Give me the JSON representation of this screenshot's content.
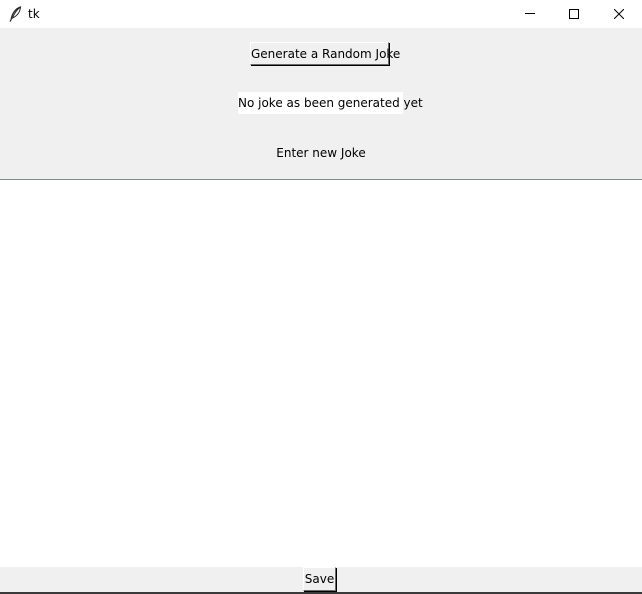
{
  "window": {
    "title": "tk",
    "icon": "feather-icon",
    "controls": [
      "minimize-icon",
      "maximize-icon",
      "close-icon"
    ]
  },
  "main": {
    "generate_button_label": "Generate a Random Joke",
    "joke_display_text": "No joke as been generated yet",
    "enter_label": "Enter new Joke",
    "joke_input_value": "",
    "save_button_label": "Save"
  },
  "colors": {
    "client_background": "#f0f0f0",
    "text_area_background": "#ffffff",
    "title_bar_background": "#ffffff"
  }
}
